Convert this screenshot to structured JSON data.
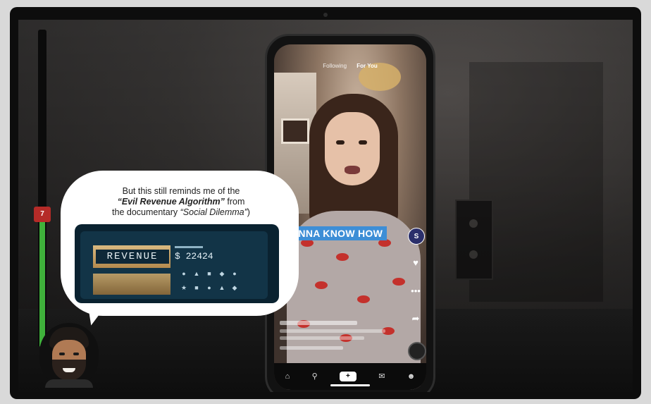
{
  "bubble": {
    "line1": "But this still reminds me of the",
    "line2_bold": "“Evil Revenue Algorithm”",
    "line2_rest": " from",
    "line3_pre": "the documentary ",
    "line3_italic": "“Social Dilemma”",
    "line3_post": ")"
  },
  "still_image": {
    "revenue_label": "REVENUE",
    "stat_value": "$ 22424"
  },
  "meter": {
    "level": 0.42,
    "marker_label": "7"
  },
  "tiktok": {
    "tabs": [
      "Following",
      "For You"
    ],
    "active_tab": "For You",
    "caption": "ANNA KNOW HOW"
  },
  "colors": {
    "caption_bg": "#3d8ed6",
    "meter_fill": "#3fb13b",
    "meter_marker": "#b52b28"
  },
  "icons": {
    "like": "heart-icon",
    "comment": "comment-icon",
    "share": "share-icon",
    "home": "home-icon",
    "discover": "search-icon",
    "create": "plus-icon",
    "inbox": "inbox-icon",
    "profile": "profile-icon"
  }
}
